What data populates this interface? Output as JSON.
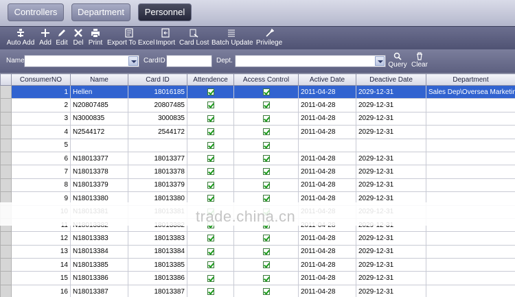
{
  "tabs": [
    {
      "label": "Controllers"
    },
    {
      "label": "Department"
    },
    {
      "label": "Personnel"
    }
  ],
  "toolbar": [
    {
      "label": "Auto Add",
      "icon": "auto-add-icon"
    },
    {
      "label": "Add",
      "icon": "plus-icon"
    },
    {
      "label": "Edit",
      "icon": "pencil-icon"
    },
    {
      "label": "Del",
      "icon": "x-icon"
    },
    {
      "label": "Print",
      "icon": "printer-icon"
    },
    {
      "label": "Export To Excel",
      "icon": "export-icon"
    },
    {
      "label": "Import",
      "icon": "import-icon"
    },
    {
      "label": "Card Lost",
      "icon": "card-lost-icon"
    },
    {
      "label": "Batch Update",
      "icon": "batch-update-icon"
    },
    {
      "label": "Privilege",
      "icon": "privilege-icon"
    }
  ],
  "filters": {
    "name_label": "Name",
    "name_value": "",
    "cardid_label": "CardID",
    "cardid_value": "",
    "dept_label": "Dept.",
    "dept_value": "",
    "query_label": "Query",
    "clear_label": "Clear"
  },
  "table": {
    "columns": [
      "ConsumerNO",
      "Name",
      "Card ID",
      "Attendence",
      "Access Control",
      "Active Date",
      "Deactive Date",
      "Department"
    ],
    "rows": [
      {
        "no": "1",
        "name": "Hellen",
        "card": "18016185",
        "att": true,
        "acc": true,
        "active": "2011-04-28",
        "deactive": "2029-12-31",
        "dept": "Sales Dep\\Oversea Marketing"
      },
      {
        "no": "2",
        "name": "N20807485",
        "card": "20807485",
        "att": true,
        "acc": true,
        "active": "2011-04-28",
        "deactive": "2029-12-31",
        "dept": ""
      },
      {
        "no": "3",
        "name": "N3000835",
        "card": "3000835",
        "att": true,
        "acc": true,
        "active": "2011-04-28",
        "deactive": "2029-12-31",
        "dept": ""
      },
      {
        "no": "4",
        "name": "N2544172",
        "card": "2544172",
        "att": true,
        "acc": true,
        "active": "2011-04-28",
        "deactive": "2029-12-31",
        "dept": ""
      },
      {
        "no": "5",
        "name": "",
        "card": "",
        "att": true,
        "acc": true,
        "active": "",
        "deactive": "",
        "dept": ""
      },
      {
        "no": "6",
        "name": "N18013377",
        "card": "18013377",
        "att": true,
        "acc": true,
        "active": "2011-04-28",
        "deactive": "2029-12-31",
        "dept": ""
      },
      {
        "no": "7",
        "name": "N18013378",
        "card": "18013378",
        "att": true,
        "acc": true,
        "active": "2011-04-28",
        "deactive": "2029-12-31",
        "dept": ""
      },
      {
        "no": "8",
        "name": "N18013379",
        "card": "18013379",
        "att": true,
        "acc": true,
        "active": "2011-04-28",
        "deactive": "2029-12-31",
        "dept": ""
      },
      {
        "no": "9",
        "name": "N18013380",
        "card": "18013380",
        "att": true,
        "acc": true,
        "active": "2011-04-28",
        "deactive": "2029-12-31",
        "dept": ""
      },
      {
        "no": "10",
        "name": "N18013381",
        "card": "18013381",
        "att": true,
        "acc": true,
        "active": "2011-04-28",
        "deactive": "2029-12-31",
        "dept": ""
      },
      {
        "no": "11",
        "name": "N18013382",
        "card": "18013382",
        "att": true,
        "acc": true,
        "active": "2011-04-28",
        "deactive": "2029-12-31",
        "dept": ""
      },
      {
        "no": "12",
        "name": "N18013383",
        "card": "18013383",
        "att": true,
        "acc": true,
        "active": "2011-04-28",
        "deactive": "2029-12-31",
        "dept": ""
      },
      {
        "no": "13",
        "name": "N18013384",
        "card": "18013384",
        "att": true,
        "acc": true,
        "active": "2011-04-28",
        "deactive": "2029-12-31",
        "dept": ""
      },
      {
        "no": "14",
        "name": "N18013385",
        "card": "18013385",
        "att": true,
        "acc": true,
        "active": "2011-04-28",
        "deactive": "2029-12-31",
        "dept": ""
      },
      {
        "no": "15",
        "name": "N18013386",
        "card": "18013386",
        "att": true,
        "acc": true,
        "active": "2011-04-28",
        "deactive": "2029-12-31",
        "dept": ""
      },
      {
        "no": "16",
        "name": "N18013387",
        "card": "18013387",
        "att": true,
        "acc": true,
        "active": "2011-04-28",
        "deactive": "2029-12-31",
        "dept": ""
      }
    ],
    "selected_row": "1"
  },
  "watermark": "trade.china.cn",
  "colors": {
    "selection": "#3163d0",
    "toolbar": "#5d6080",
    "check": "#1a9a1a"
  }
}
